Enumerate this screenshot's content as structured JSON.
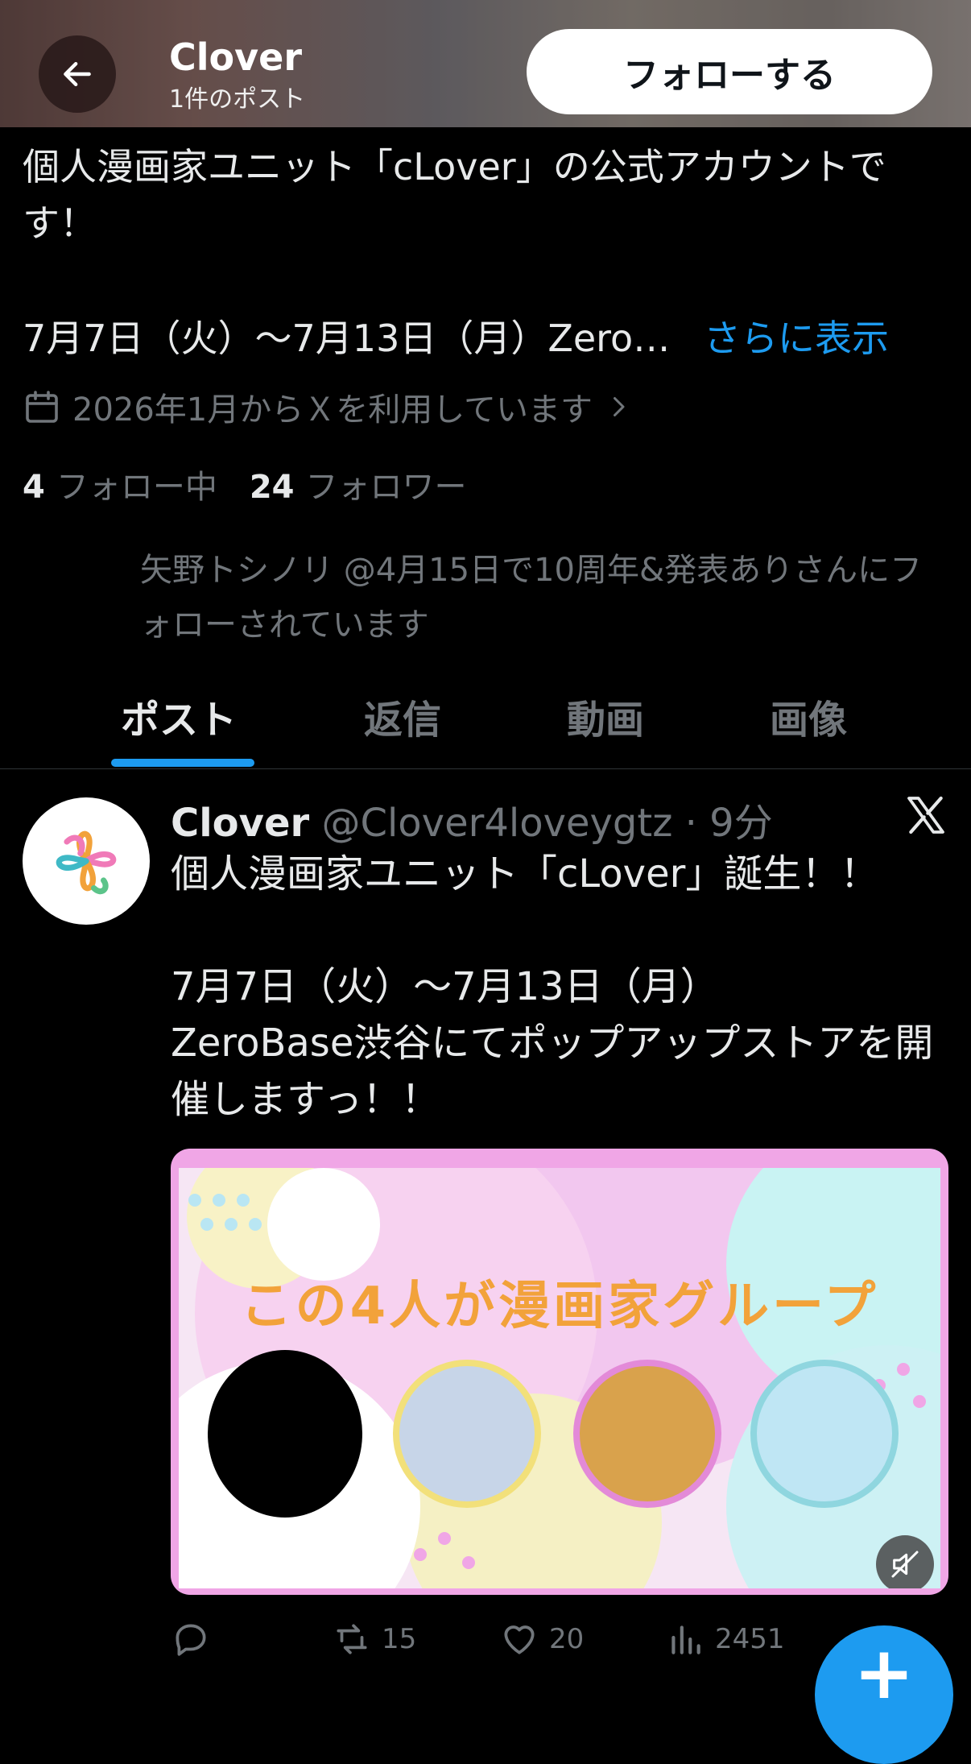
{
  "header": {
    "name": "Clover",
    "post_count": "1件のポスト",
    "follow_label": "フォローする"
  },
  "bio": {
    "line1": "個人漫画家ユニット「cLover」の公式アカウントです！",
    "line2": "7月7日（火）〜7月13日（月）Zero…",
    "show_more": "さらに表示",
    "joined": "2026年1月からＸを利用しています"
  },
  "stats": {
    "following_count": "4",
    "following_label": "フォロー中",
    "followers_count": "24",
    "followers_label": "フォロワー"
  },
  "followed_by": "矢野トシノリ @4月15日で10周年&発表ありさんにフォローされています",
  "tabs": [
    "ポスト",
    "返信",
    "動画",
    "画像"
  ],
  "post": {
    "name": "Clover",
    "handle_time": "@Clover4loveygtz · 9分",
    "text": "個人漫画家ユニット「cLover」誕生！！\n\n7月7日（火）〜7月13日（月）\nZeroBase渋谷にてポップアップストアを開催しますっ！！",
    "media_title": "この4人が漫画家グループ",
    "replies": "",
    "reposts": "15",
    "likes": "20",
    "views": "2451"
  },
  "colors": {
    "accent": "#1d9bf0",
    "background": "#000000",
    "muted": "#71767b"
  },
  "icons": [
    "back-arrow-icon",
    "calendar-icon",
    "chevron-right-icon",
    "x-logo-icon",
    "reply-icon",
    "repost-icon",
    "like-icon",
    "views-icon",
    "mute-icon",
    "plus-icon"
  ]
}
